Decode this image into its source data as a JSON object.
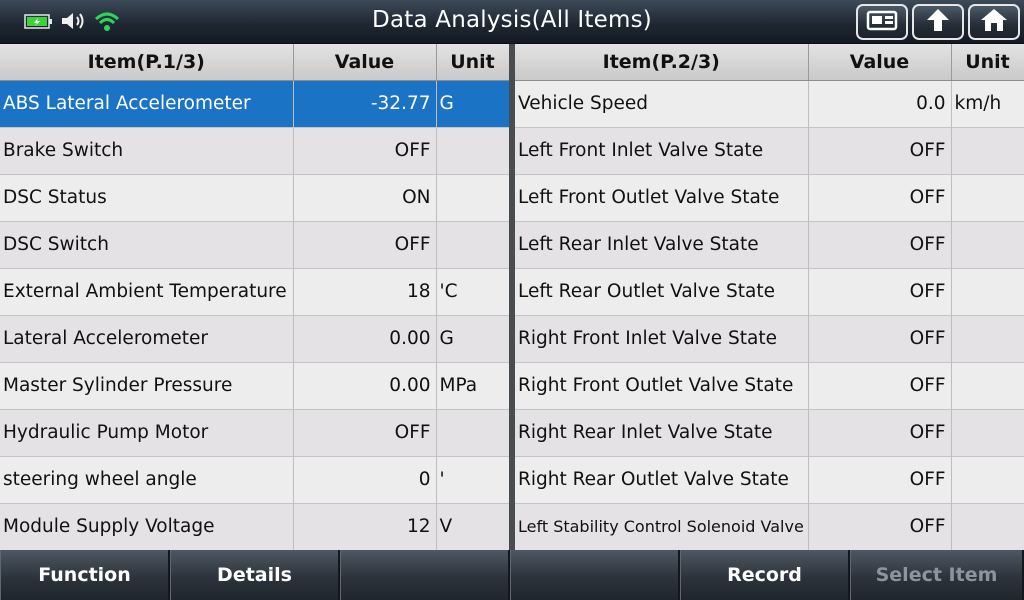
{
  "header": {
    "title": "Data Analysis(All Items)"
  },
  "left_table": {
    "col_item": "Item(P.1/3)",
    "col_value": "Value",
    "col_unit": "Unit",
    "rows": [
      {
        "item": "ABS Lateral Accelerometer",
        "value": "-32.77",
        "unit": "G"
      },
      {
        "item": "Brake Switch",
        "value": "OFF",
        "unit": ""
      },
      {
        "item": "DSC Status",
        "value": "ON",
        "unit": ""
      },
      {
        "item": "DSC Switch",
        "value": "OFF",
        "unit": ""
      },
      {
        "item": "External Ambient Temperature",
        "value": "18",
        "unit": "'C"
      },
      {
        "item": "Lateral Accelerometer",
        "value": "0.00",
        "unit": "G"
      },
      {
        "item": "Master Sylinder Pressure",
        "value": "0.00",
        "unit": "MPa"
      },
      {
        "item": "Hydraulic Pump Motor",
        "value": "OFF",
        "unit": ""
      },
      {
        "item": "steering wheel angle",
        "value": "0",
        "unit": "'"
      },
      {
        "item": "Module Supply Voltage",
        "value": "12",
        "unit": "V"
      }
    ]
  },
  "right_table": {
    "col_item": "Item(P.2/3)",
    "col_value": "Value",
    "col_unit": "Unit",
    "rows": [
      {
        "item": "Vehicle Speed",
        "value": "0.0",
        "unit": "km/h"
      },
      {
        "item": "Left Front Inlet Valve State",
        "value": "OFF",
        "unit": ""
      },
      {
        "item": "Left Front Outlet Valve State",
        "value": "OFF",
        "unit": ""
      },
      {
        "item": "Left Rear Inlet Valve State",
        "value": "OFF",
        "unit": ""
      },
      {
        "item": "Left Rear Outlet Valve State",
        "value": "OFF",
        "unit": ""
      },
      {
        "item": "Right Front Inlet Valve State",
        "value": "OFF",
        "unit": ""
      },
      {
        "item": "Right Front Outlet Valve State",
        "value": "OFF",
        "unit": ""
      },
      {
        "item": "Right Rear Inlet Valve State",
        "value": "OFF",
        "unit": ""
      },
      {
        "item": "Right Rear Outlet Valve State",
        "value": "OFF",
        "unit": ""
      },
      {
        "item": "Left Stability Control Solenoid Valve",
        "value": "OFF",
        "unit": ""
      }
    ]
  },
  "footer": {
    "buttons": [
      "Function",
      "Details",
      "",
      "",
      "Record",
      "Select Item"
    ]
  },
  "icons": {
    "battery": "battery-icon",
    "volume": "volume-icon",
    "wifi": "wifi-icon",
    "screenshot": "screenshot-icon",
    "back": "back-arrow-icon",
    "home": "home-icon"
  },
  "colors": {
    "selected_row": "#1a73c4",
    "battery": "#3ad43a",
    "wifi": "#2fd35a"
  }
}
